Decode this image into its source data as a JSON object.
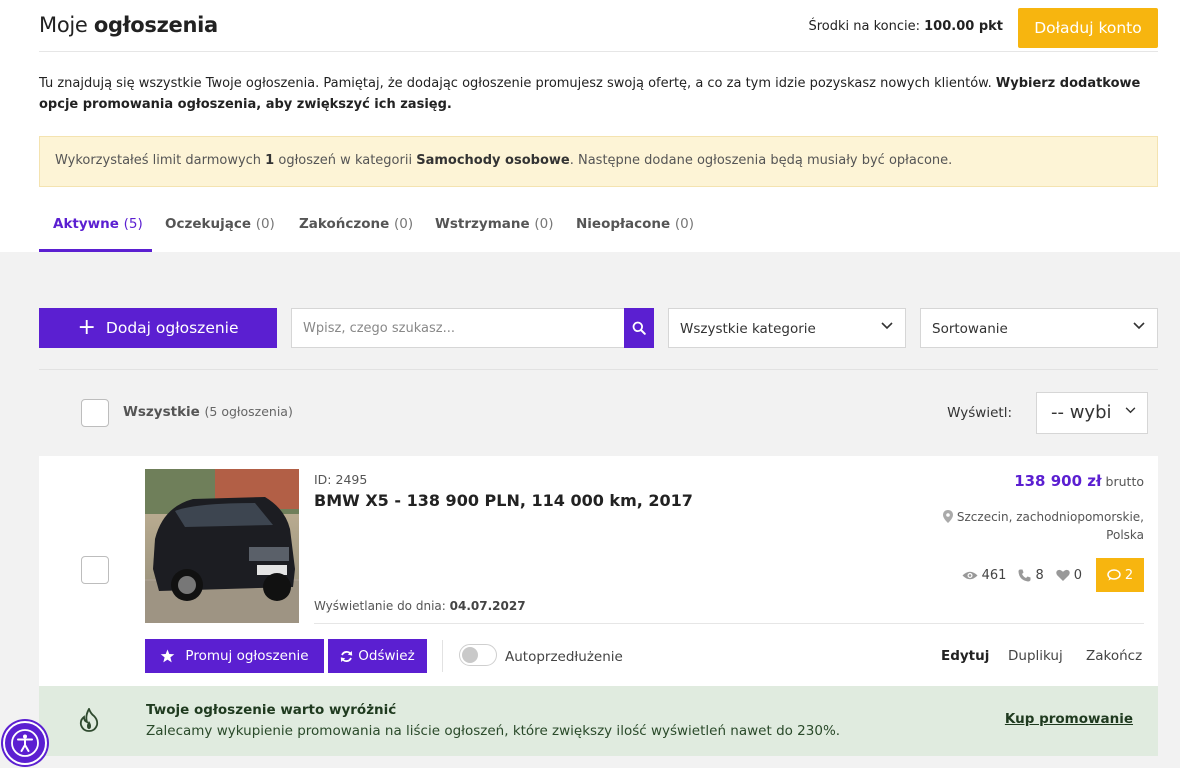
{
  "header": {
    "title_prefix": "Moje",
    "title_bold": "ogłoszenia",
    "balance_label": "Środki na koncie:",
    "balance_value": "100.00 pkt",
    "topup_label": "Doładuj konto"
  },
  "intro": {
    "text": "Tu znajdują się wszystkie Twoje ogłoszenia. Pamiętaj, że dodając ogłoszenie promujesz swoją ofertę, a co za tym idzie pozyskasz nowych klientów.",
    "bold": "Wybierz dodatkowe opcje promowania ogłoszenia, aby zwiększyć ich zasięg."
  },
  "notice": {
    "part1": "Wykorzystałeś limit darmowych",
    "limit": "1",
    "part2": "ogłoszeń w kategorii",
    "category": "Samochody osobowe",
    "part3": ". Następne dodane ogłoszenia będą musiały być opłacone."
  },
  "tabs": [
    {
      "label": "Aktywne",
      "count": "(5)"
    },
    {
      "label": "Oczekujące",
      "count": "(0)"
    },
    {
      "label": "Zakończone",
      "count": "(0)"
    },
    {
      "label": "Wstrzymane",
      "count": "(0)"
    },
    {
      "label": "Nieopłacone",
      "count": "(0)"
    }
  ],
  "toolbar": {
    "add_label": "Dodaj ogłoszenie",
    "search_placeholder": "Wpisz, czego szukasz...",
    "category_select": "Wszystkie kategorie",
    "sort_select": "Sortowanie"
  },
  "list_header": {
    "all_label": "Wszystkie",
    "all_count": "(5 ogłoszenia)",
    "show_label": "Wyświetl:",
    "show_value": "-- wybi"
  },
  "listing": {
    "id": "ID: 2495",
    "title": "BMW X5 - 138 900 PLN, 114 000 km, 2017",
    "display_until_label": "Wyświetlanie do dnia:",
    "display_until_date": "04.07.2027",
    "price": "138 900 zł",
    "price_suffix": "brutto",
    "location_line1": "Szczecin, zachodniopomorskie,",
    "location_line2": "Polska",
    "views": "461",
    "phones": "8",
    "likes": "0",
    "messages": "2",
    "promote_label": "Promuj ogłoszenie",
    "refresh_label": "Odśwież",
    "auto_label": "Autoprzedłużenie",
    "edit_label": "Edytuj",
    "duplicate_label": "Duplikuj",
    "end_label": "Zakończ"
  },
  "promo_banner": {
    "title": "Twoje ogłoszenie warto wyróżnić",
    "text": "Zalecamy wykupienie promowania na liście ogłoszeń, które zwiększy ilość wyświetleń nawet do 230%.",
    "link": "Kup promowanie"
  },
  "colors": {
    "accent": "#5b1fd1",
    "warning": "#f7b50f",
    "notice_bg": "#fdf4d6",
    "promo_bg": "#e0ebdf"
  }
}
